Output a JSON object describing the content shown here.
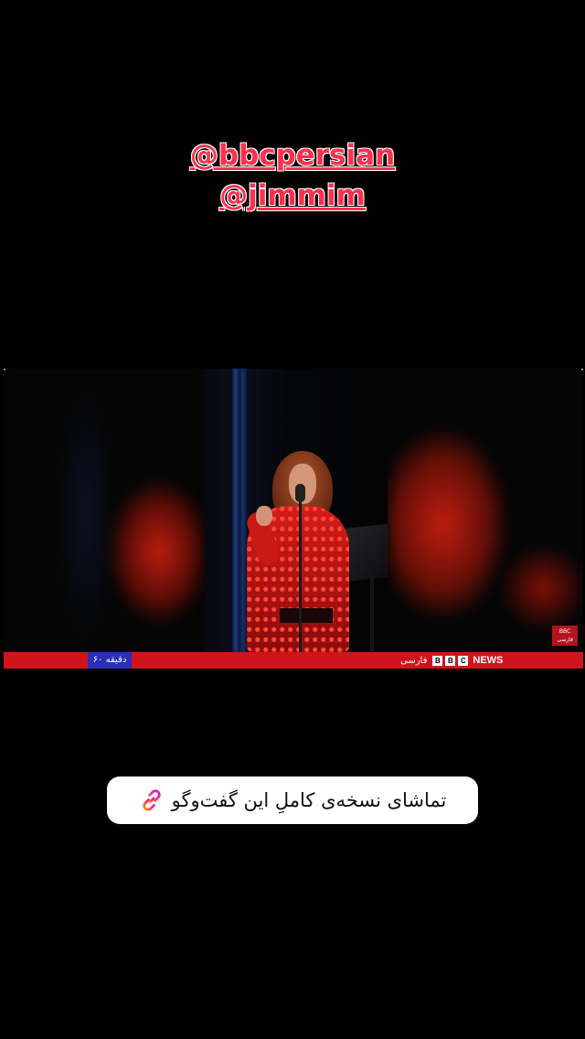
{
  "mentions": [
    "@bbcpersian",
    "@jimmim"
  ],
  "video": {
    "corner_logo": "BBC فارسی",
    "ticker": {
      "program": "۶۰ دقیقه",
      "language": "فارسی",
      "bbc_letters": [
        "B",
        "B",
        "C"
      ],
      "news_label": "NEWS"
    }
  },
  "link_sticker": {
    "text": "تماشای نسخه‌ی کاملِ این گفت‌وگو",
    "icon": "link-icon"
  },
  "colors": {
    "mention": "#ff2f4e",
    "ticker_red": "#d0141c",
    "program_blue": "#2a2fb7",
    "background": "#000000"
  }
}
